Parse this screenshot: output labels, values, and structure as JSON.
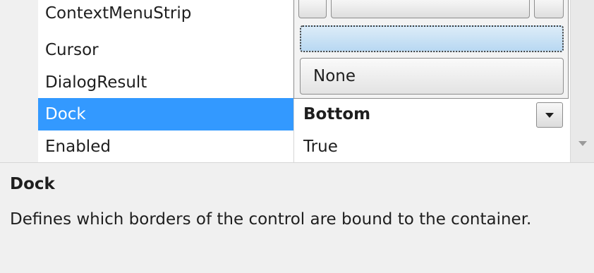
{
  "properties": [
    {
      "name": "ContextMenuStrip",
      "value": ""
    },
    {
      "name": "Cursor",
      "value": ""
    },
    {
      "name": "DialogResult",
      "value": ""
    },
    {
      "name": "Dock",
      "value": "Bottom"
    },
    {
      "name": "Enabled",
      "value": "True"
    }
  ],
  "dock_editor": {
    "none_label": "None"
  },
  "description": {
    "title": "Dock",
    "text": "Defines which borders of the control are bound to the container."
  },
  "colors": {
    "selection": "#3399ff",
    "fill_highlight": "#b8d8f2"
  },
  "icons": {
    "dropdown": "chevron-down-icon",
    "scroll": "scroll-down-icon"
  }
}
